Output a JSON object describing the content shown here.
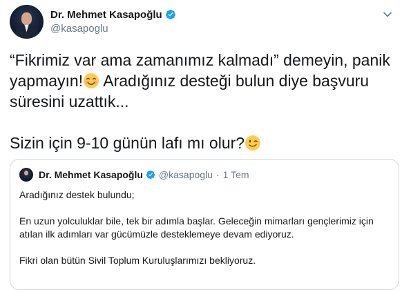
{
  "author": {
    "name": "Dr. Mehmet Kasapoğlu",
    "handle": "@kasapoglu"
  },
  "tweet": {
    "line1": "“Fikrimiz var ama zamanımız kalmadı” demeyin, panik",
    "line2a": "yapmayın!",
    "line2b": " Aradığınız desteği bulun diye başvuru",
    "line3": "süresini uzattık...",
    "line4": "Sizin için 9-10 günün lafı mı olur?"
  },
  "emojis": {
    "first": "smiling-face-with-blush",
    "second": "winking-face"
  },
  "quoted_tweet": {
    "name": "Dr. Mehmet Kasapoğlu",
    "handle": "@kasapoglu",
    "separator": "·",
    "time": "1 Tem",
    "line1": "Aradığınız destek bulundu;",
    "line2": "En uzun yolculuklar bile, tek bir adımla başlar. Geleceğin mimarları gençlerimiz için",
    "line3": "atılan ilk adımları var gücümüzle desteklemeye devam ediyoruz.",
    "line4": "Fikri olan bütün Sivil Toplum Kuruluşlarımızı bekliyoruz."
  },
  "colors": {
    "verified": "#1da1f2",
    "secondary_text": "#657786",
    "border": "#ccd6dd"
  }
}
